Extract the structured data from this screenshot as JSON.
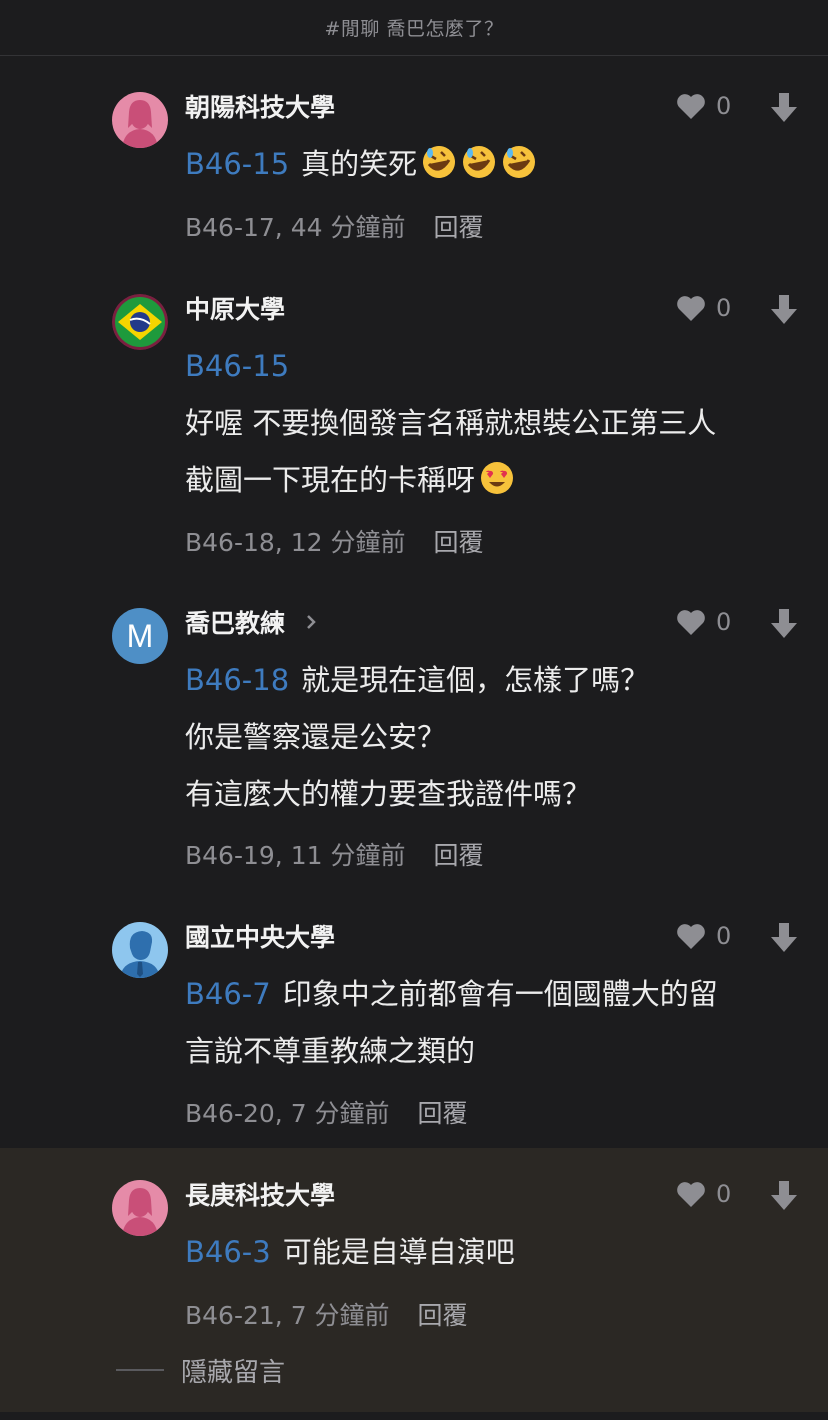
{
  "header": {
    "title": "#閒聊 喬巴怎麼了？"
  },
  "icons": {
    "like": "heart-icon",
    "dislike": "down-arrow-icon",
    "profile": "chevron-right-icon"
  },
  "colors": {
    "link": "#3e7bbf",
    "muted": "#8e8e93",
    "highlight_bg": "#2b2824"
  },
  "comments": [
    {
      "author": "朝陽科技大學",
      "avatar": "female-silhouette-pink",
      "likes": "0",
      "ref": "B46-15",
      "lines": [
        "真的笑死"
      ],
      "emoji": "rolling-on-floor-laughing x3",
      "meta": "B46-17, 44 分鐘前",
      "reply": "回覆"
    },
    {
      "author": "中原大學",
      "avatar": "brazil-flag",
      "likes": "0",
      "ref": "B46-15",
      "lines": [
        "好喔 不要換個發言名稱就想裝公正第三人",
        "截圖一下現在的卡稱呀"
      ],
      "emoji": "heart-eyes",
      "meta": "B46-18, 12 分鐘前",
      "reply": "回覆"
    },
    {
      "author": "喬巴教練",
      "avatar_letter": "M",
      "likes": "0",
      "ref": "B46-18",
      "lines": [
        "就是現在這個，怎樣了嗎？",
        "你是警察還是公安？",
        "有這麼大的權力要查我證件嗎？"
      ],
      "meta": "B46-19, 11 分鐘前",
      "reply": "回覆"
    },
    {
      "author": "國立中央大學",
      "avatar": "male-silhouette-blue",
      "likes": "0",
      "ref": "B46-7",
      "lines": [
        "印象中之前都會有一個國體大的留",
        "言說不尊重教練之類的"
      ],
      "meta": "B46-20, 7 分鐘前",
      "reply": "回覆"
    },
    {
      "author": "長庚科技大學",
      "avatar": "female-silhouette-pink",
      "likes": "0",
      "ref": "B46-3",
      "lines": [
        "可能是自導自演吧"
      ],
      "meta": "B46-21, 7 分鐘前",
      "reply": "回覆"
    }
  ],
  "hide_comments": "隱藏留言"
}
